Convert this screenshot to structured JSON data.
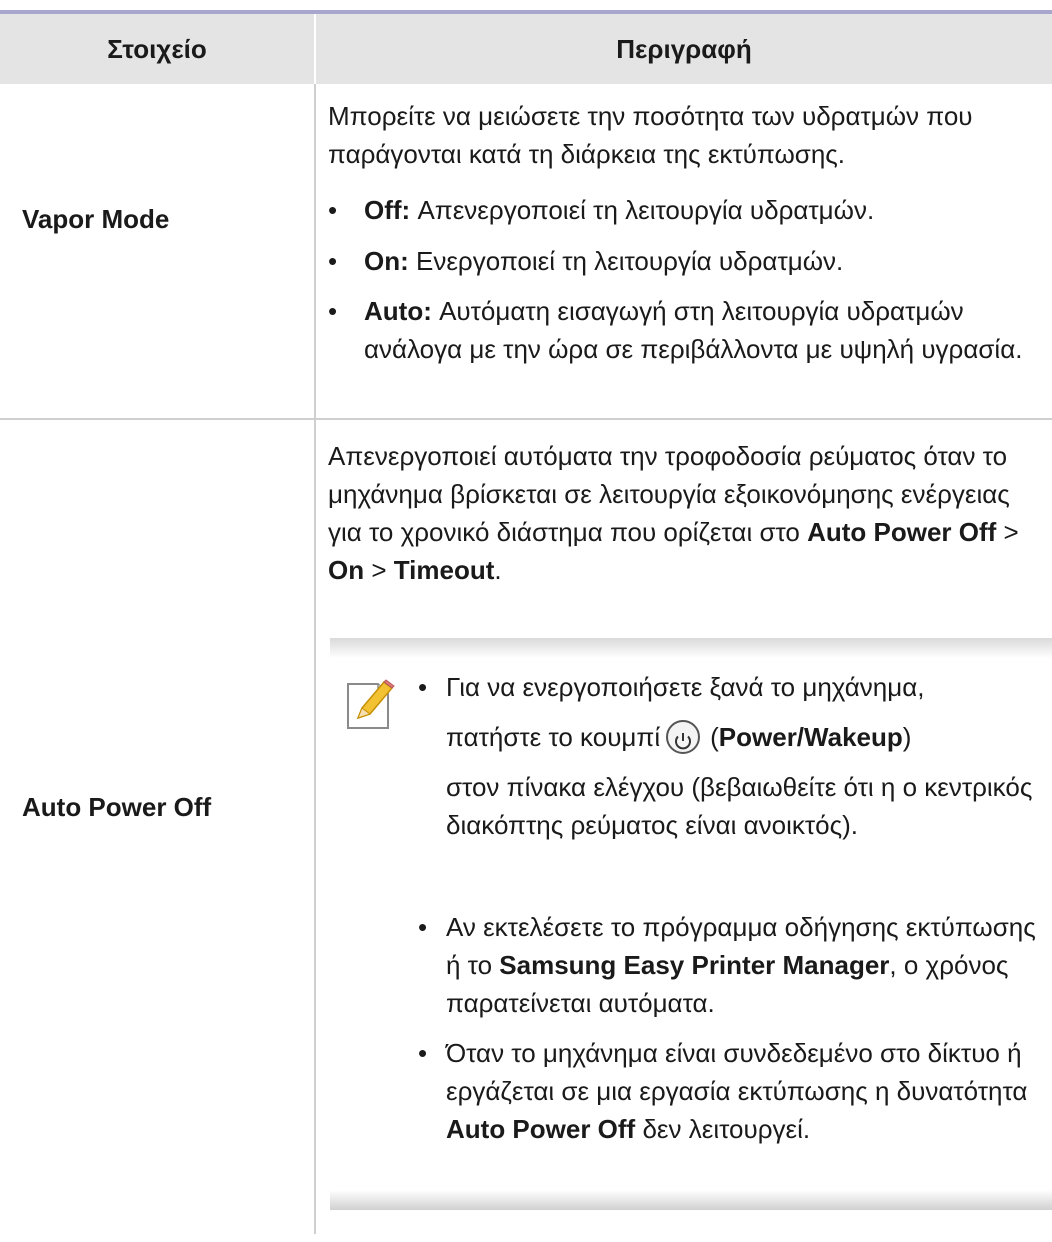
{
  "table": {
    "headers": {
      "item": "Στοιχείο",
      "description": "Περιγραφή"
    },
    "rows": [
      {
        "item": "Vapor Mode",
        "intro": "Μπορείτε να μειώσετε την ποσότητα των υδρατμών που παράγονται κατά τη διάρκεια της εκτύπωσης.",
        "options": [
          {
            "term": "Off:",
            "text": "Απενεργοποιεί τη λειτουργία υδρατμών."
          },
          {
            "term": "On:",
            "text": "Ενεργοποιεί τη λειτουργία υδρατμών."
          },
          {
            "term": "Auto:",
            "text": "Αυτόματη εισαγωγή στη λειτουργία υδρατμών ανάλογα με την ώρα σε περιβάλλοντα με υψηλή υγρασία."
          }
        ]
      },
      {
        "item": "Auto Power Off",
        "intro_prefix": "Απενεργοποιεί αυτόματα την τροφοδοσία ρεύματος όταν το μηχάνημα βρίσκεται σε λειτουργία εξοικονόμησης ενέργειας για το χρονικό διάστημα που ορίζεται στο",
        "menu_path": [
          "Auto Power Off",
          "On",
          "Timeout"
        ],
        "path_separator": ">",
        "intro_suffix": ".",
        "note": {
          "icon": "note-pencil-icon",
          "bullets": [
            {
              "line1": "Για να ενεργοποιήσετε ξανά το μηχάνημα,",
              "line2_prefix": "πατήστε το κουμπί",
              "power_icon": "power-icon",
              "button_name": "Power/Wakeup",
              "open_paren": "(",
              "close_paren": ")",
              "rest": "στον πίνακα ελέγχου (βεβαιωθείτε ότι η ο κεντρικός διακόπτης ρεύματος είναι ανοικτός)."
            },
            {
              "prefix": "Αν εκτελέσετε το πρόγραμμα οδήγησης εκτύπωσης ή το",
              "bold": "Samsung Easy Printer Manager",
              "suffix": ", ο χρόνος παρατείνεται αυτόματα."
            },
            {
              "prefix": "Όταν το μηχάνημα είναι συνδεδεμένο στο δίκτυο ή εργάζεται σε μια εργασία εκτύπωσης η δυνατότητα",
              "bold": "Auto Power Off",
              "suffix": "δεν λειτουργεί."
            }
          ]
        }
      }
    ]
  },
  "colors": {
    "header_bg": "#e4e4e4",
    "top_rule": "#a8a6cc",
    "divider": "#cfcfcf"
  }
}
